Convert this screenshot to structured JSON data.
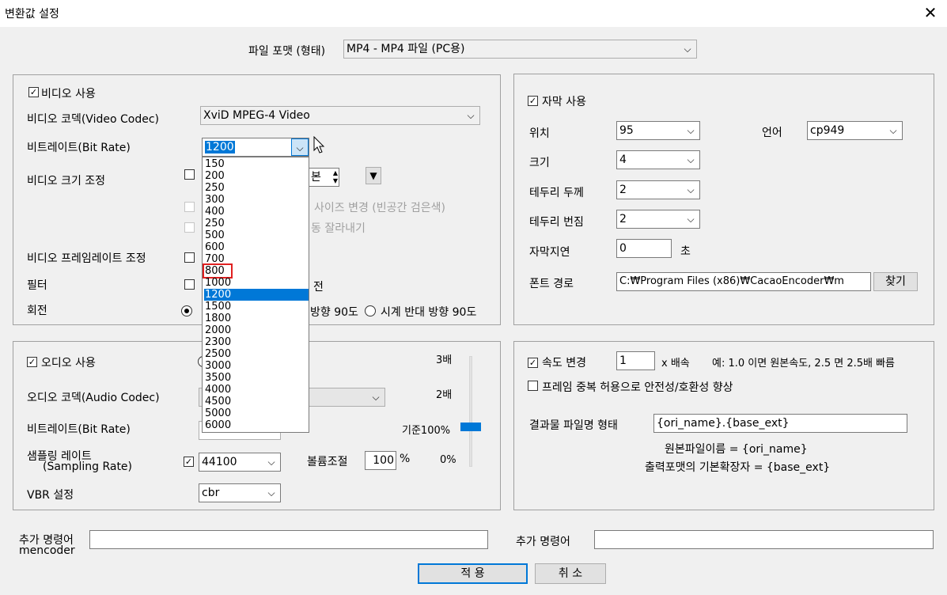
{
  "window": {
    "title": "변환값 설정",
    "close_glyph": "✕"
  },
  "format": {
    "label": "파일 포맷 (형태)",
    "value": "MP4 - MP4 파일 (PC용)"
  },
  "video": {
    "enable_label": "비디오 사용",
    "codec_label": "비디오 코덱(Video Codec)",
    "codec_value": "XviD MPEG-4 Video",
    "bitrate_label": "비트레이트(Bit Rate)",
    "bitrate_value": "1200",
    "bitrate_options": [
      "150",
      "200",
      "250",
      "300",
      "400",
      "250",
      "500",
      "600",
      "700",
      "800",
      "1000",
      "1200",
      "1500",
      "1800",
      "2000",
      "2300",
      "2500",
      "3000",
      "3500",
      "4000",
      "4500",
      "5000",
      "6000"
    ],
    "resize_label": "비디오 크기 조정",
    "resize_spin_tail": "본",
    "keep_ratio_label": "사이즈 변경 (빈공간 검은색)",
    "auto_crop_label": "동 잘라내기",
    "framerate_label": "비디오 프레임레이트 조정",
    "filter_label": "필터",
    "filter_tail": "전",
    "rotate_label": "회전",
    "rotate_opt1_tail": "방향 90도",
    "rotate_opt2": "시계 반대 방향 90도"
  },
  "audio": {
    "enable_label": "오디오 사용",
    "codec_label": "오디오 코덱(Audio Codec)",
    "bitrate_label": "비트레이트(Bit Rate)",
    "sampling_label_1": "샘플링 레이트",
    "sampling_label_2": "(Sampling Rate)",
    "sampling_value": "44100",
    "volume_label": "볼륨조절",
    "volume_value": "100",
    "volume_unit": "%",
    "vbr_label": "VBR 설정",
    "vbr_value": "cbr",
    "scale_3x": "3배",
    "scale_2x": "2배",
    "scale_base": "기준100%",
    "scale_0": "0%",
    "slider_level_percent": 100
  },
  "subtitle": {
    "enable_label": "자막 사용",
    "position_label": "위치",
    "position_value": "95",
    "language_label": "언어",
    "language_value": "cp949",
    "size_label": "크기",
    "size_value": "4",
    "border_label": "테두리 두께",
    "border_value": "2",
    "blur_label": "테두리 번짐",
    "blur_value": "2",
    "delay_label": "자막지연",
    "delay_value": "0",
    "delay_unit": "초",
    "font_path_label": "폰트 경로",
    "font_path_value": "C:₩Program Files (x86)₩CacaoEncoder₩m",
    "browse_label": "찾기"
  },
  "speed": {
    "enable_label": "속도 변경",
    "value": "1",
    "unit": "x 배속",
    "hint": "예: 1.0 이면 원본속도, 2.5 면 2.5배 빠름",
    "dup_frame_label": "프레임 중복 허용으로 안전성/호환성 향상",
    "output_name_label": "결과물 파일명 형태",
    "output_name_value": "{ori_name}.{base_ext}",
    "help_1": "원본파일이름 = {ori_name}",
    "help_2": "출력포맷의 기본확장자 = {base_ext}"
  },
  "extra": {
    "mencoder_label_1": "추가 명령어",
    "mencoder_label_2": "mencoder",
    "other_label": "추가 명령어"
  },
  "buttons": {
    "apply": "적 용",
    "cancel": "취 소"
  },
  "colors": {
    "accent": "#0078d7",
    "highlight_box": "#e02020"
  }
}
